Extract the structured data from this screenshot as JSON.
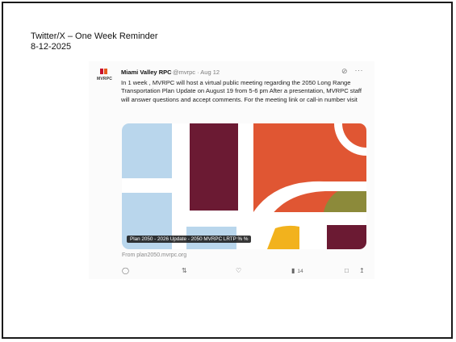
{
  "slide": {
    "title": "Twitter/X – One Week Reminder",
    "date": "8-12-2025"
  },
  "tweet": {
    "author_name": "Miami Valley RPC",
    "author_meta": "@mvrpc · Aug 12",
    "avatar_text": "MVRPC",
    "text": "In 1 week , MVRPC will host a virtual public meeting regarding the 2050 Long Range Transportation Plan Update on August 19 from 5-6 pm After a presentation, MVRPC staff will answer questions and accept comments. For the meeting link or call-in number visit",
    "media_caption": "Plan 2050 - 2026 Update - 2050 MVRPC LRTP % %",
    "source_link": "From plan2050.mvrpc.org",
    "views_count": "14"
  },
  "icons": {
    "grok": "grok-icon",
    "more": "more-icon",
    "reply": "reply-icon",
    "repost": "repost-icon",
    "like": "like-icon",
    "views": "views-icon",
    "bookmark": "bookmark-icon",
    "share": "share-icon"
  },
  "colors": {
    "light_blue": "#b9d6ec",
    "maroon": "#6b1a33",
    "orange_red": "#e05633",
    "olive": "#8c8a3a",
    "yellow": "#f2b21d",
    "mvrpc_red": "#c8102e"
  }
}
